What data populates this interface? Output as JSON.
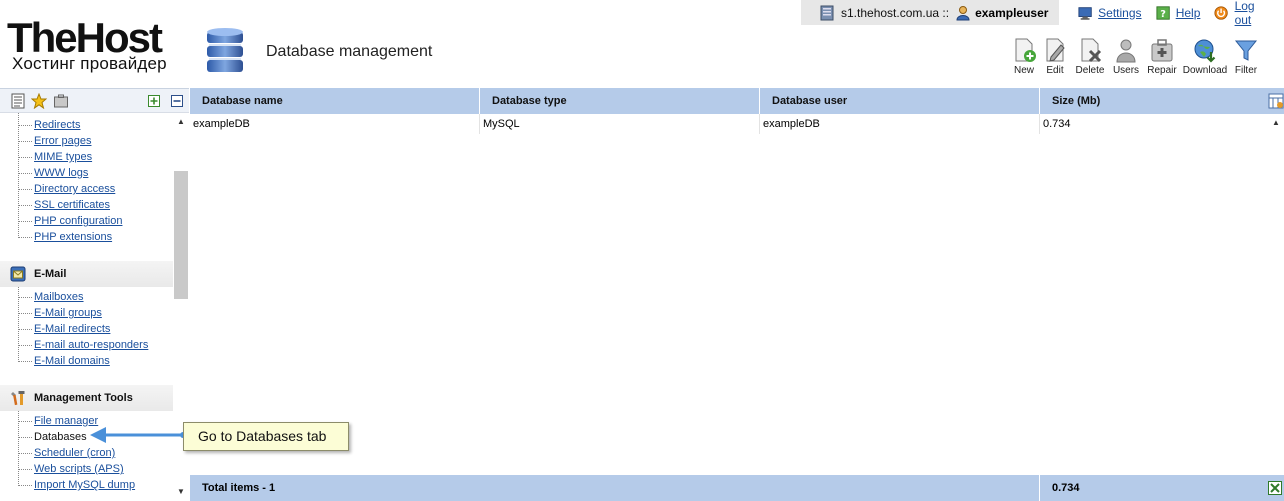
{
  "brand": {
    "name": "TheHost",
    "tagline": "Хостинг провайдер"
  },
  "page": {
    "title": "Database management"
  },
  "session": {
    "server": "s1.thehost.com.ua ::",
    "user": "exampleuser"
  },
  "top_links": [
    {
      "label": "Settings",
      "icon": "settings-monitor-icon"
    },
    {
      "label": "Help",
      "icon": "help-icon"
    },
    {
      "label": "Log out",
      "icon": "power-icon"
    }
  ],
  "toolbar": [
    {
      "label": "New",
      "icon": "new-document-icon"
    },
    {
      "label": "Edit",
      "icon": "edit-document-icon"
    },
    {
      "label": "Delete",
      "icon": "delete-document-icon"
    },
    {
      "label": "Users",
      "icon": "users-icon"
    },
    {
      "label": "Repair",
      "icon": "repair-kit-icon"
    },
    {
      "label": "Download",
      "icon": "download-globe-icon"
    },
    {
      "label": "Filter",
      "icon": "filter-icon"
    }
  ],
  "sidebar": {
    "tabs": [
      "list-tab-icon",
      "favorites-star-icon",
      "briefcase-icon"
    ],
    "controls": [
      "expand-all-icon",
      "collapse-all-icon"
    ],
    "top_items": [
      "Redirects",
      "Error pages",
      "MIME types",
      "WWW logs",
      "Directory access",
      "SSL certificates",
      "PHP configuration",
      "PHP extensions"
    ],
    "groups": [
      {
        "title": "E-Mail",
        "icon": "email-group-icon",
        "items": [
          "Mailboxes",
          "E-Mail groups",
          "E-Mail redirects",
          "E-mail auto-responders",
          "E-Mail domains"
        ]
      },
      {
        "title": "Management Tools",
        "icon": "tools-group-icon",
        "items": [
          "File manager",
          "Databases",
          "Scheduler (cron)",
          "Web scripts (APS)",
          "Import MySQL dump"
        ],
        "active": "Databases"
      }
    ]
  },
  "table": {
    "columns": [
      "Database name",
      "Database type",
      "Database user",
      "Size (Mb)"
    ],
    "rows": [
      [
        "exampleDB",
        "MySQL",
        "exampleDB",
        "0.734"
      ]
    ],
    "footer": {
      "label": "Total items - 1",
      "total_size": "0.734"
    }
  },
  "annotation": {
    "text": "Go to Databases tab",
    "color": "#4a90d9"
  },
  "colors": {
    "header_row": "#b5cbe9",
    "link": "#1a4f9c",
    "callout_bg": "#fcfdd6"
  }
}
